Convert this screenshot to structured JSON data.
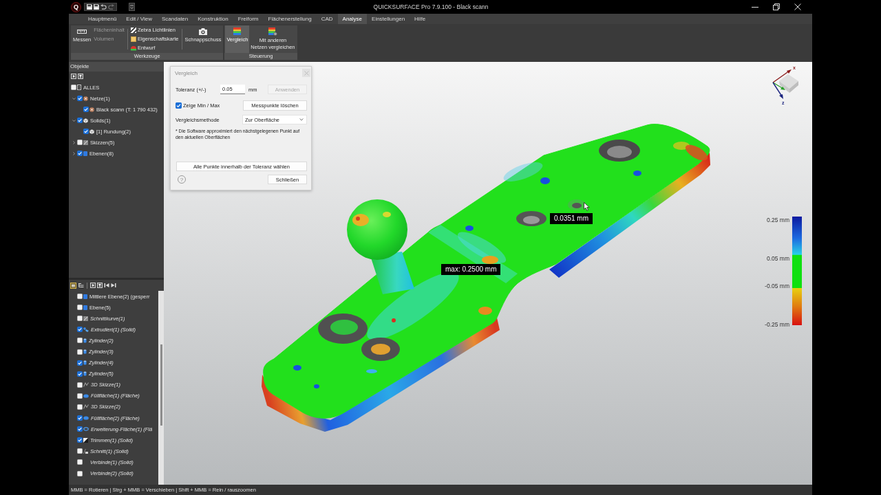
{
  "window": {
    "logo": "Q",
    "title": "QUICKSURFACE Pro 7.9.100 - Black scann"
  },
  "menu": [
    {
      "label": "Hauptmenü",
      "selected": false
    },
    {
      "label": "Edit / View",
      "selected": false
    },
    {
      "label": "Scandaten",
      "selected": false
    },
    {
      "label": "Konstruktion",
      "selected": false
    },
    {
      "label": "Freiform",
      "selected": false
    },
    {
      "label": "Flächenerstellung",
      "selected": false
    },
    {
      "label": "CAD",
      "selected": false
    },
    {
      "label": "Analyse",
      "selected": true
    },
    {
      "label": "Einstellungen",
      "selected": false
    },
    {
      "label": "Hilfe",
      "selected": false
    }
  ],
  "ribbon": [
    {
      "group": "Werkzeuge",
      "tools": [
        {
          "kind": "large",
          "label": "Messen",
          "selected": false,
          "disabled": false
        },
        {
          "kind": "stack",
          "items": [
            {
              "label": "Flächeninhalt",
              "disabled": true
            },
            {
              "label": "Volumen",
              "disabled": true
            }
          ]
        },
        {
          "kind": "stack",
          "items": [
            {
              "label": "Zebra Lichtlinien",
              "disabled": false
            },
            {
              "label": "Eigenschaftskarte",
              "disabled": false
            },
            {
              "label": "Entwurf",
              "disabled": false
            }
          ]
        },
        {
          "kind": "large",
          "label": "Schnappschuss",
          "selected": false,
          "disabled": false
        }
      ]
    },
    {
      "group": "Steuerung",
      "tools": [
        {
          "kind": "large",
          "label": "Vergleich",
          "selected": true,
          "disabled": false
        },
        {
          "kind": "large",
          "label": "Mit anderen\nNetzen vergleichen",
          "selected": false,
          "disabled": false
        }
      ]
    }
  ],
  "objects": {
    "title": "Objekte",
    "tree": [
      {
        "label": "ALLES",
        "kind": "all",
        "checked": false,
        "children": [
          {
            "label": "Netze(1)",
            "kind": "mesh",
            "checked": true,
            "expanded": true,
            "children": [
              {
                "label": "Black scann (T: 1 790 432)",
                "kind": "mesh",
                "checked": true
              }
            ]
          },
          {
            "label": "Solids(1)",
            "kind": "solid",
            "checked": true,
            "expanded": true,
            "children": [
              {
                "label": "[1] Rundung(2)",
                "kind": "solid",
                "checked": true
              }
            ]
          },
          {
            "label": "Skizzen(5)",
            "kind": "sketch",
            "checked": false,
            "expanded": false
          },
          {
            "label": "Ebenen(8)",
            "kind": "plane",
            "checked": true,
            "expanded": false
          }
        ]
      }
    ]
  },
  "features": [
    {
      "label": "Mittlere Ebene(2) (gesperr",
      "kind": "plane",
      "checked": false
    },
    {
      "label": "Ebene(5)",
      "kind": "plane",
      "checked": false
    },
    {
      "label": "Schnittkurve(1)",
      "kind": "curve",
      "checked": false
    },
    {
      "label": "Extrudiert(1) (Solid)",
      "kind": "extrude",
      "checked": true
    },
    {
      "label": "Zylinder(2)",
      "kind": "cylinder",
      "checked": false
    },
    {
      "label": "Zylinder(3)",
      "kind": "cylinder",
      "checked": false
    },
    {
      "label": "Zylinder(4)",
      "kind": "cylinder",
      "checked": true
    },
    {
      "label": "Zylinder(5)",
      "kind": "cylinder",
      "checked": true
    },
    {
      "label": "3D Skizze(1)",
      "kind": "sketch",
      "checked": false
    },
    {
      "label": "Füllfläche(1) (Fläche)",
      "kind": "fill",
      "checked": false
    },
    {
      "label": "3D Skizze(2)",
      "kind": "sketch",
      "checked": false
    },
    {
      "label": "Füllfläche(2) (Fläche)",
      "kind": "fill",
      "checked": true
    },
    {
      "label": "Erweiterung-Fläche(1) (Flä",
      "kind": "extend",
      "checked": true
    },
    {
      "label": "Trimmen(1) (Solid)",
      "kind": "trim",
      "checked": true
    },
    {
      "label": "Schnitt(1) (Solid)",
      "kind": "cut",
      "checked": false
    },
    {
      "label": "Verbinde(1) (Solid)",
      "kind": "join",
      "checked": false
    },
    {
      "label": "Verbinde(2) (Solid)",
      "kind": "join",
      "checked": false
    }
  ],
  "compare_dialog": {
    "title": "Vergleich",
    "tolerance": {
      "label": "Toleranz (+/-)",
      "value": "0.05",
      "unit": "mm"
    },
    "apply_button": {
      "label": "Anwenden",
      "disabled": true
    },
    "show_min_max": {
      "label": "Zeige Min / Max",
      "checked": true
    },
    "clear_button": "Messpunkte löschen",
    "method": {
      "label": "Vergleichsmethode",
      "value": "Zur Oberfläche"
    },
    "note": "* Die Software approximiert den nächstgelegenen Punkt auf den aktuellen Oberflächen",
    "select_button": "Alle Punkte innerhalb der Toleranz wählen",
    "help": "?",
    "close_button": "Schließen"
  },
  "viewport": {
    "labels": [
      {
        "kind": "point",
        "text": "0.0351 mm"
      },
      {
        "kind": "max",
        "text": "max: 0.2500 mm"
      }
    ],
    "legend": [
      "0.25 mm",
      "0.05 mm",
      "-0.05 mm",
      "-0.25 mm"
    ],
    "axes": [
      "x",
      "z"
    ]
  },
  "status_bar": "MMB = Rotieren | Strg + MMB = Verschieben | Shift + MMB = Rein / rauszoomen"
}
